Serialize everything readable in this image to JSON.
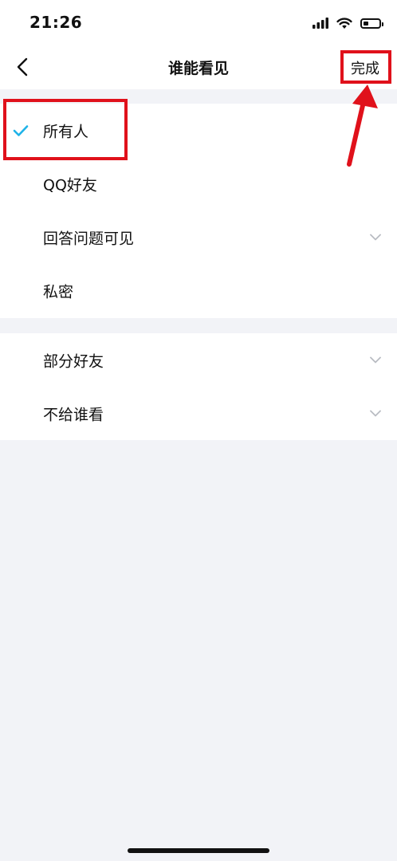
{
  "status_bar": {
    "time": "21:26",
    "icons": [
      "signal-icon",
      "wifi-icon",
      "battery-icon"
    ]
  },
  "nav": {
    "back_icon": "chevron-left-icon",
    "title": "谁能看见",
    "done_label": "完成"
  },
  "options_group_1": [
    {
      "label": "所有人",
      "selected": true,
      "has_chevron": false
    },
    {
      "label": "QQ好友",
      "selected": false,
      "has_chevron": false
    },
    {
      "label": "回答问题可见",
      "selected": false,
      "has_chevron": true
    },
    {
      "label": "私密",
      "selected": false,
      "has_chevron": false
    }
  ],
  "options_group_2": [
    {
      "label": "部分好友",
      "selected": false,
      "has_chevron": true
    },
    {
      "label": "不给谁看",
      "selected": false,
      "has_chevron": true
    }
  ],
  "colors": {
    "accent_check": "#1fb3e8",
    "annotation_red": "#e0111b",
    "background": "#f2f3f7",
    "chevron": "#b9bcc2"
  },
  "annotations": {
    "highlight_targets": [
      "options_group_1.0",
      "nav.done_label"
    ],
    "arrow_target": "nav.done_label"
  }
}
